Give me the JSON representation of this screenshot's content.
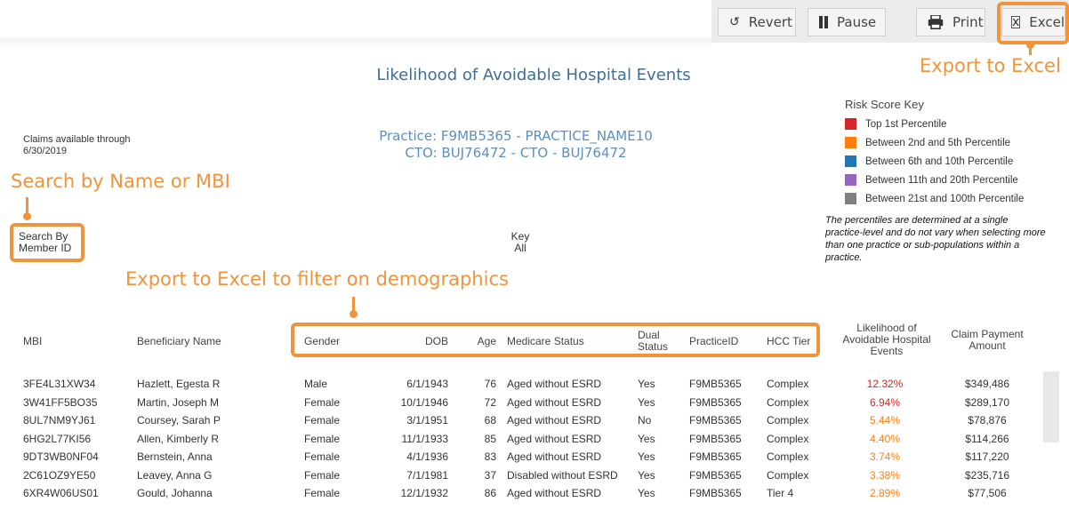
{
  "toolbar": {
    "revert_label": "Revert",
    "pause_label": "Pause",
    "print_label": "Print",
    "excel_label": "Excel"
  },
  "annotations": {
    "export_excel": "Export to Excel",
    "search_by": "Search by Name or MBI",
    "filter_demographics": "Export to Excel to filter on demographics"
  },
  "report": {
    "title": "Likelihood of Avoidable Hospital Events",
    "practice_line": "Practice: F9MB5365 - PRACTICE_NAME10",
    "cto_line": "CTO: BUJ76472 - CTO - BUJ76472",
    "claims_line1": "Claims available through",
    "claims_line2": "6/30/2019"
  },
  "risk_key": {
    "title": "Risk Score Key",
    "items": [
      {
        "label": "Top 1st Percentile",
        "color": "#d62728"
      },
      {
        "label": "Between 2nd and 5th Percentile",
        "color": "#ff7f0e"
      },
      {
        "label": "Between 6th and 10th Percentile",
        "color": "#1f77b4"
      },
      {
        "label": "Between 11th and 20th Percentile",
        "color": "#9467bd"
      },
      {
        "label": "Between 21st and 100th Percentile",
        "color": "#7f7f7f"
      }
    ],
    "note": "The percentiles are determined at a single practice-level and do not vary when selecting more than one practice or sub-populations within a practice."
  },
  "filters": {
    "search_label": "Search By",
    "search_value": "Member ID",
    "key_label": "Key",
    "key_value": "All"
  },
  "table": {
    "headers": {
      "mbi": "MBI",
      "name": "Beneficiary Name",
      "gender": "Gender",
      "dob": "DOB",
      "age": "Age",
      "medicare": "Medicare Status",
      "dual": "Dual Status",
      "practice": "PracticeID",
      "hcc": "HCC Tier",
      "likelihood": "Likelihood of Avoidable Hospital Events",
      "claim": "Claim Payment Amount"
    },
    "rows": [
      {
        "mbi": "3FE4L31XW34",
        "name": "Hazlett, Egesta R",
        "gender": "Male",
        "dob": "6/1/1943",
        "age": "76",
        "medicare": "Aged without ESRD",
        "dual": "Yes",
        "practice": "F9MB5365",
        "hcc": "Complex",
        "likelihood": "12.32%",
        "claim": "$349,486",
        "color": "#d62728"
      },
      {
        "mbi": "3W41FF5BO35",
        "name": "Martin, Joseph M",
        "gender": "Female",
        "dob": "10/1/1946",
        "age": "72",
        "medicare": "Aged without ESRD",
        "dual": "Yes",
        "practice": "F9MB5365",
        "hcc": "Complex",
        "likelihood": "6.94%",
        "claim": "$289,170",
        "color": "#d62728"
      },
      {
        "mbi": "8UL7NM9YJ61",
        "name": "Coursey, Sarah P",
        "gender": "Female",
        "dob": "3/1/1951",
        "age": "68",
        "medicare": "Aged without ESRD",
        "dual": "No",
        "practice": "F9MB5365",
        "hcc": "Complex",
        "likelihood": "5.44%",
        "claim": "$78,876",
        "color": "#ff7f0e"
      },
      {
        "mbi": "6HG2L77KI56",
        "name": "Allen, Kimberly R",
        "gender": "Female",
        "dob": "11/1/1933",
        "age": "85",
        "medicare": "Aged without ESRD",
        "dual": "Yes",
        "practice": "F9MB5365",
        "hcc": "Complex",
        "likelihood": "4.40%",
        "claim": "$114,266",
        "color": "#ff7f0e"
      },
      {
        "mbi": "9DT3WB0NF04",
        "name": "Bernstein, Anna",
        "gender": "Female",
        "dob": "4/1/1936",
        "age": "83",
        "medicare": "Aged without ESRD",
        "dual": "Yes",
        "practice": "F9MB5365",
        "hcc": "Complex",
        "likelihood": "3.74%",
        "claim": "$117,220",
        "color": "#ff7f0e"
      },
      {
        "mbi": "2C61OZ9YE50",
        "name": "Leavey, Anna G",
        "gender": "Female",
        "dob": "7/1/1981",
        "age": "37",
        "medicare": "Disabled without ESRD",
        "dual": "Yes",
        "practice": "F9MB5365",
        "hcc": "Complex",
        "likelihood": "3.38%",
        "claim": "$235,716",
        "color": "#ff7f0e"
      },
      {
        "mbi": "6XR4W06US01",
        "name": "Gould, Johanna",
        "gender": "Female",
        "dob": "12/1/1932",
        "age": "86",
        "medicare": "Aged without ESRD",
        "dual": "Yes",
        "practice": "F9MB5365",
        "hcc": "Tier 4",
        "likelihood": "2.89%",
        "claim": "$77,506",
        "color": "#ff7f0e"
      }
    ]
  }
}
